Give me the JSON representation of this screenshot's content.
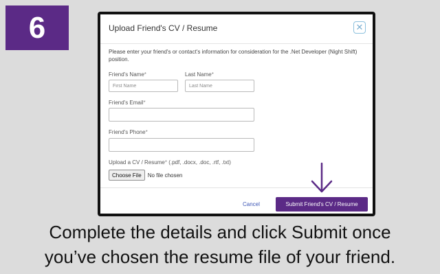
{
  "step": {
    "number": "6"
  },
  "dialog": {
    "title": "Upload Friend's CV / Resume",
    "close_glyph": "✕",
    "intro": "Please enter your friend's or contact's information for consideration for the .Net Developer (Night Shift) position.",
    "fields": {
      "first_name": {
        "label": "Friend's Name",
        "placeholder": "First Name",
        "value": ""
      },
      "last_name": {
        "label": "Last Name",
        "placeholder": "Last Name",
        "value": ""
      },
      "email": {
        "label": "Friend's Email",
        "value": ""
      },
      "phone": {
        "label": "Friend's Phone",
        "value": ""
      }
    },
    "required_marker": "*",
    "upload": {
      "label": "Upload a CV / Resume",
      "formats": "(.pdf, .docx, .doc, .rtf, .txt)",
      "choose_button": "Choose File",
      "status": "No file chosen"
    },
    "cancel_label": "Cancel",
    "submit_label": "Submit Friend's CV / Resume"
  },
  "caption": {
    "line1": "Complete the details and click Submit once",
    "line2": "you’ve chosen the resume file of your friend."
  },
  "colors": {
    "brand_purple": "#5b2a86",
    "background": "#dcdcdc",
    "link_blue": "#3b55b5"
  },
  "icons": {
    "close": "close-icon",
    "arrow": "arrow-down-icon"
  }
}
